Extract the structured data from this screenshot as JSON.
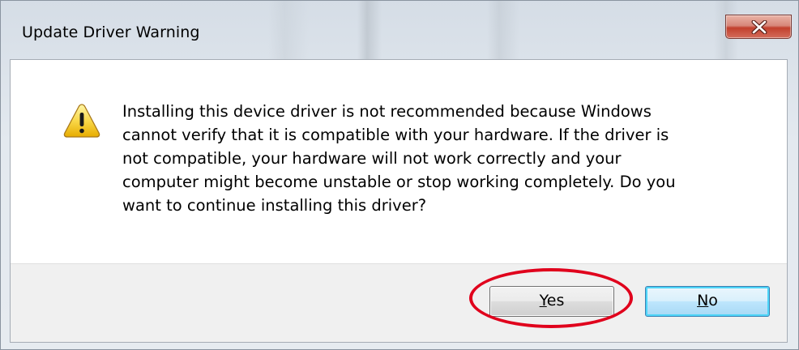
{
  "dialog": {
    "title": "Update Driver Warning",
    "message_lines": [
      "Installing this device driver is not recommended because Windows",
      "cannot verify that it is compatible with your hardware.  If the driver is",
      "not compatible, your hardware will not work correctly and your",
      "computer might become unstable or stop working completely.  Do you",
      "want to continue installing this driver?"
    ],
    "icon": "warning-icon",
    "close_icon": "close-icon"
  },
  "buttons": {
    "yes": {
      "accel": "Y",
      "rest": "es"
    },
    "no": {
      "accel": "N",
      "rest": "o"
    }
  },
  "colors": {
    "close_button": "#c2402d",
    "highlight_ring": "#e0001c",
    "warning_yellow": "#f5c400",
    "default_button_border": "#3c7fb1"
  }
}
